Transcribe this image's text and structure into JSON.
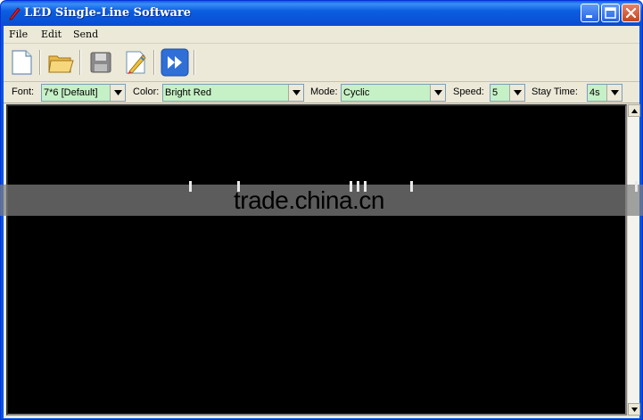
{
  "window": {
    "title": "LED Single-Line Software",
    "icon": "pen-icon",
    "controls": [
      "minimize-icon",
      "maximize-icon",
      "close-icon"
    ]
  },
  "menu": {
    "items": [
      "File",
      "Edit",
      "Send"
    ]
  },
  "toolbar": {
    "buttons": [
      {
        "name": "new",
        "icon": "new-document-icon"
      },
      {
        "name": "open",
        "icon": "open-folder-icon"
      },
      {
        "name": "save",
        "icon": "save-disk-icon"
      },
      {
        "name": "edit",
        "icon": "edit-brush-icon"
      },
      {
        "name": "send",
        "icon": "fast-forward-icon"
      }
    ]
  },
  "options": {
    "font_label": "Font:",
    "font_value": "7*6 [Default]",
    "color_label": "Color:",
    "color_value": "Bright Red",
    "mode_label": "Mode:",
    "mode_value": "Cyclic",
    "speed_label": "Speed:",
    "speed_value": "5",
    "stay_label": "Stay Time:",
    "stay_value": "4s"
  },
  "watermark": {
    "text": "trade.china.cn"
  },
  "colors": {
    "title_bar": "#0a52d6",
    "client_bg": "#ece9d8",
    "combo_bg": "#c6f0c6",
    "display_bg": "#000000"
  }
}
